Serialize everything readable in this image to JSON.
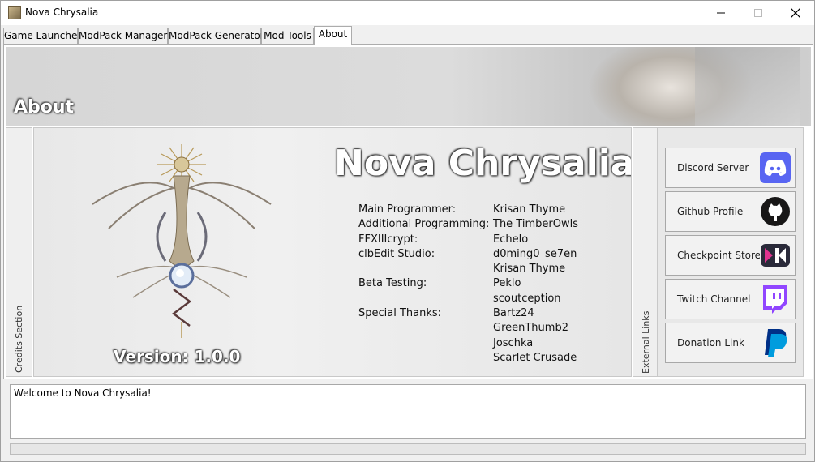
{
  "window": {
    "title": "Nova Chrysalia"
  },
  "tabs": [
    {
      "label": "Game Launcher"
    },
    {
      "label": "ModPack Manager"
    },
    {
      "label": "ModPack Generator"
    },
    {
      "label": "Mod Tools"
    },
    {
      "label": "About",
      "active": true
    }
  ],
  "banner": {
    "title": "About"
  },
  "credits": {
    "section_label": "Credits Section",
    "app_name": "Nova Chrysalia",
    "version": "Version: 1.0.0",
    "rows": [
      {
        "role": "Main Programmer:",
        "name": "Krisan Thyme"
      },
      {
        "role": "Additional Programming:",
        "name": "The TimberOwls"
      },
      {
        "role": "FFXIIIcrypt:",
        "name": "Echelo"
      },
      {
        "role": "clbEdit Studio:",
        "name": "d0ming0_se7en"
      },
      {
        "role": "",
        "name": "Krisan Thyme"
      },
      {
        "role": "Beta Testing:",
        "name": "Peklo"
      },
      {
        "role": "",
        "name": "scoutception"
      },
      {
        "role": "Special Thanks:",
        "name": "Bartz24"
      },
      {
        "role": "",
        "name": "GreenThumb2"
      },
      {
        "role": "",
        "name": "Joschka"
      },
      {
        "role": "",
        "name": "Scarlet Crusade"
      }
    ]
  },
  "links": {
    "section_label": "External Links",
    "items": [
      {
        "label": "Discord Server",
        "icon": "discord-icon",
        "color": "#5865F2"
      },
      {
        "label": "Github Profile",
        "icon": "github-icon",
        "color": "#181717"
      },
      {
        "label": "Checkpoint Store",
        "icon": "checkpoint-store-icon",
        "color": "#e0338f"
      },
      {
        "label": "Twitch Channel",
        "icon": "twitch-icon",
        "color": "#9146FF"
      },
      {
        "label": "Donation Link",
        "icon": "paypal-icon",
        "color": "#003087"
      }
    ]
  },
  "log": {
    "text": "Welcome to Nova Chrysalia!"
  },
  "progress": {
    "value": 0
  }
}
